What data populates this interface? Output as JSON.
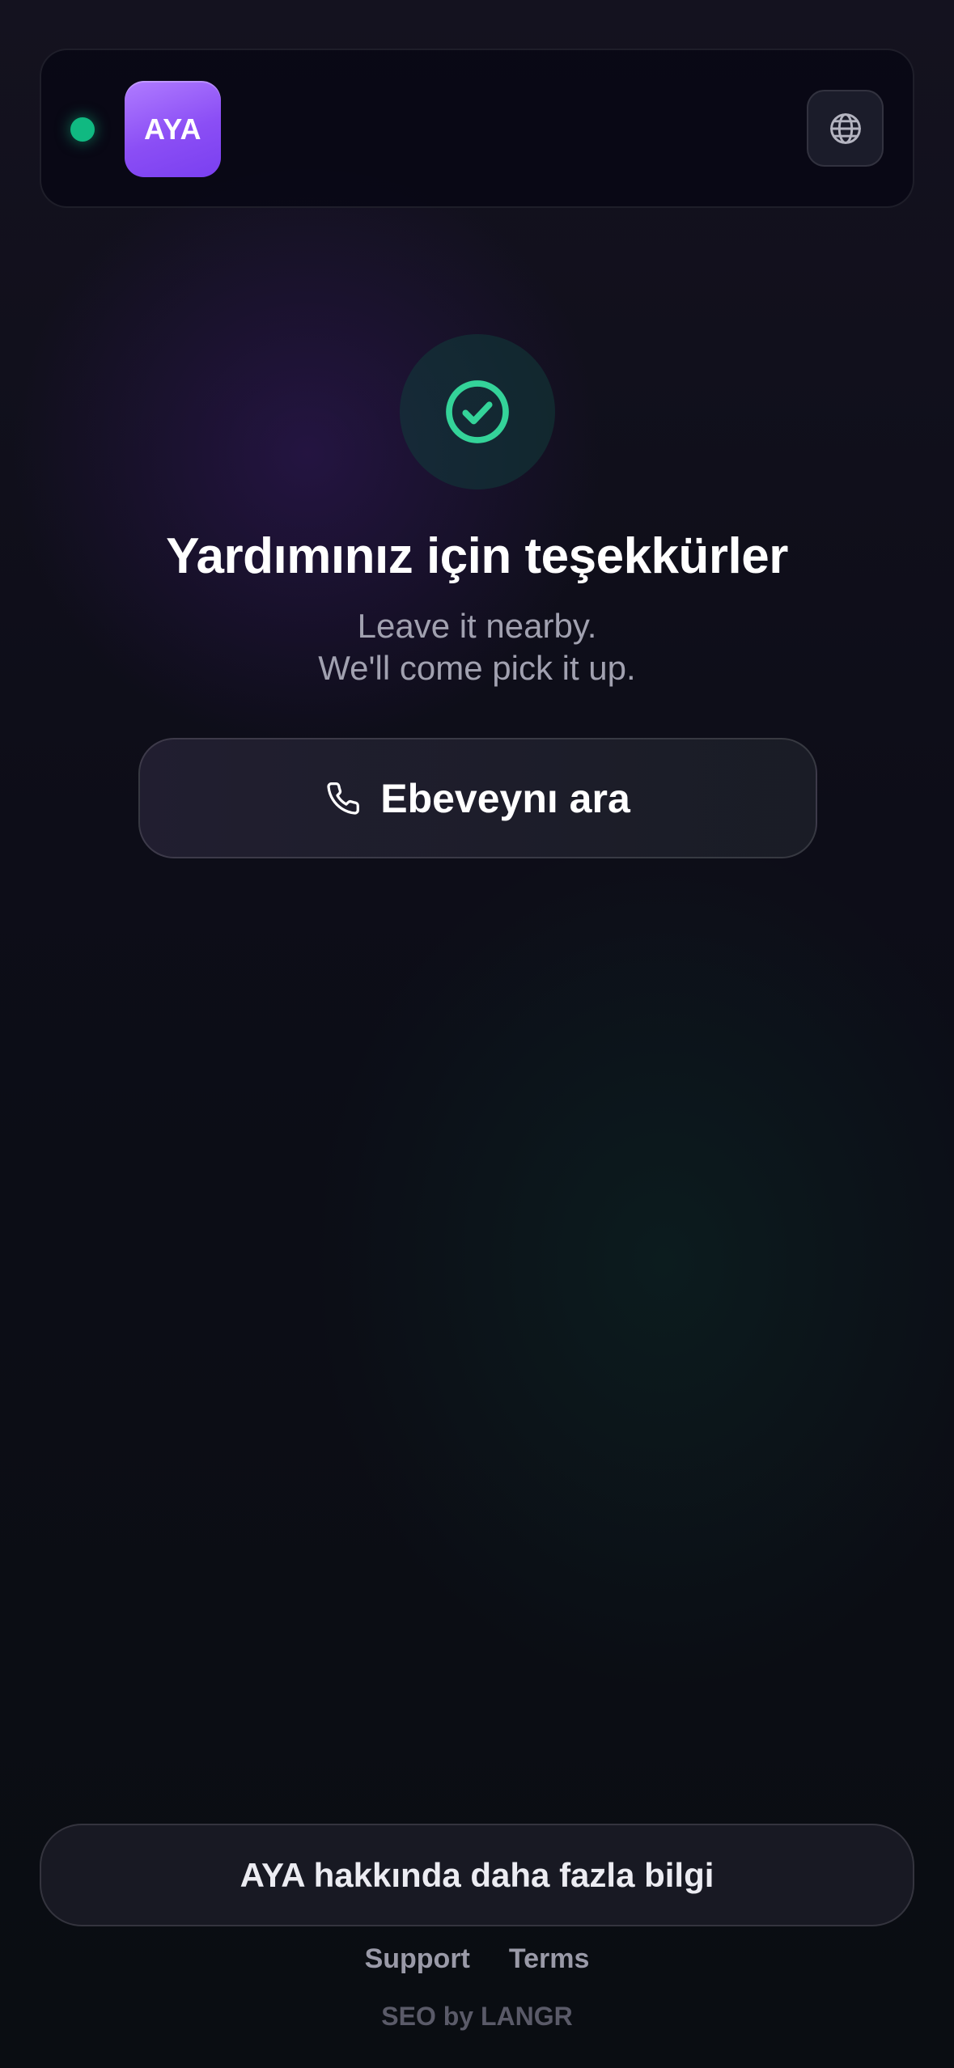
{
  "header": {
    "status": "online",
    "logo_text": "AYA",
    "language_icon": "globe-icon"
  },
  "success": {
    "icon": "check-circle-icon",
    "title": "Yardımınız için teşekkürler",
    "subtitle_line1": "Leave it nearby.",
    "subtitle_line2": "We'll come pick it up."
  },
  "call_button": {
    "icon": "phone-icon",
    "label": "Ebeveynı ara"
  },
  "footer": {
    "more_label": "AYA hakkında daha fazla bilgi",
    "links": [
      "Support",
      "Terms"
    ],
    "credit": "SEO by LANGR"
  },
  "colors": {
    "accent_purple": "#8b4ef5",
    "success_green": "#34d399",
    "status_green": "#10b981",
    "background": "#0b0b14"
  }
}
